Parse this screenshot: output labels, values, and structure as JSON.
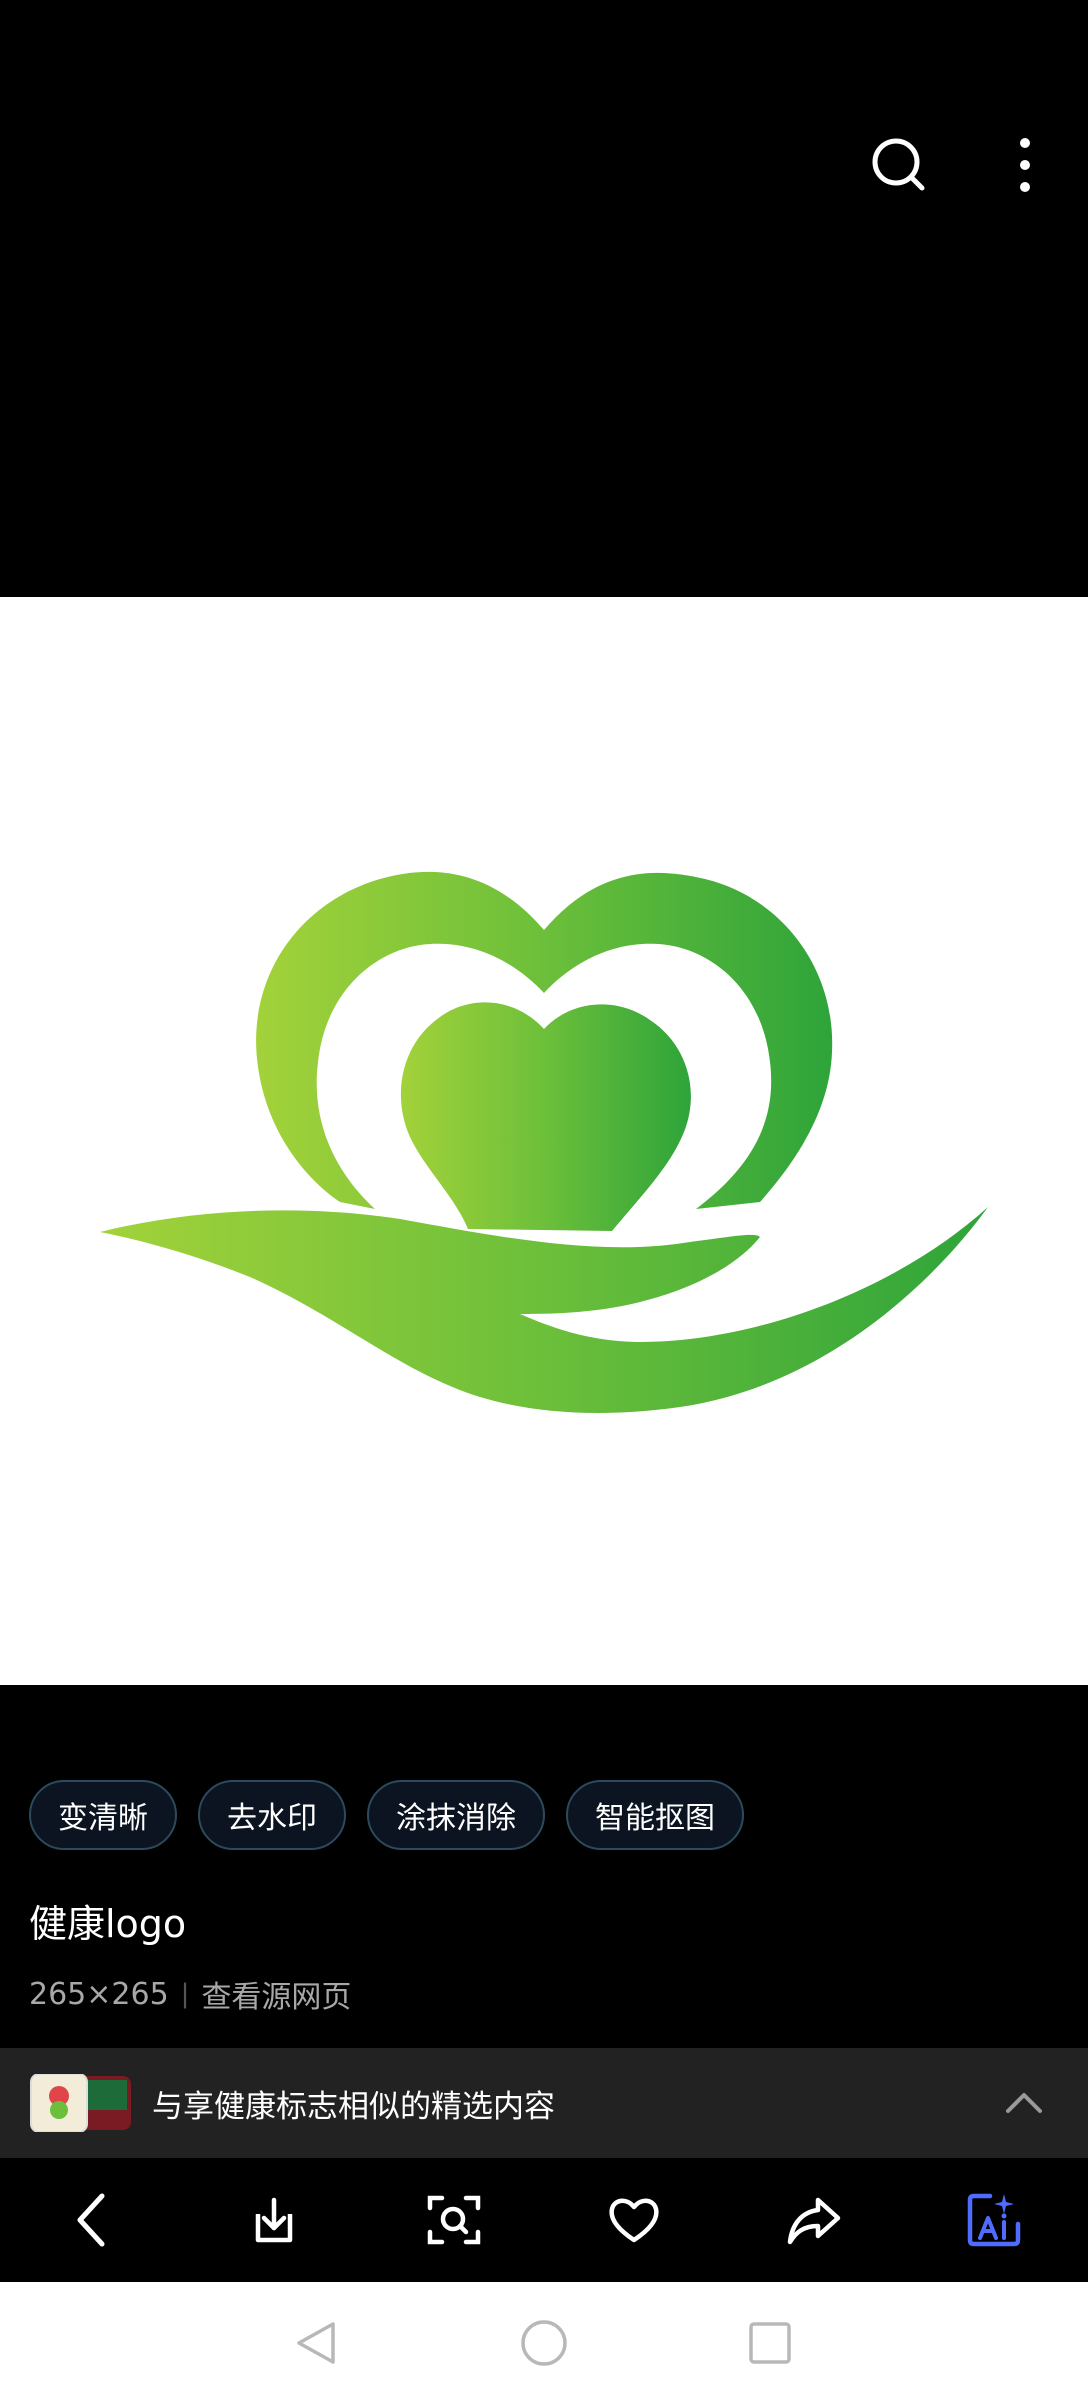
{
  "topbar": {
    "search_icon": "search-icon",
    "more_icon": "more-vertical-icon"
  },
  "image": {
    "description_icon": "heart-hand-logo"
  },
  "chips": [
    {
      "label": "变清晰"
    },
    {
      "label": "去水印"
    },
    {
      "label": "涂抹消除"
    },
    {
      "label": "智能抠图"
    }
  ],
  "info": {
    "title": "健康logo",
    "size": "265×265",
    "separator": "|",
    "source_link": "查看源网页"
  },
  "similar": {
    "text": "与享健康标志相似的精选内容"
  },
  "toolbar": {
    "items": [
      "back-icon",
      "download-icon",
      "visual-search-icon",
      "favorite-icon",
      "share-icon",
      "ai-edit-icon"
    ]
  },
  "colors": {
    "accent_ai": "#4f6cff",
    "logo_green_light": "#9fd037",
    "logo_green_dark": "#2ea43a",
    "chip_border": "#2c4a5c"
  }
}
